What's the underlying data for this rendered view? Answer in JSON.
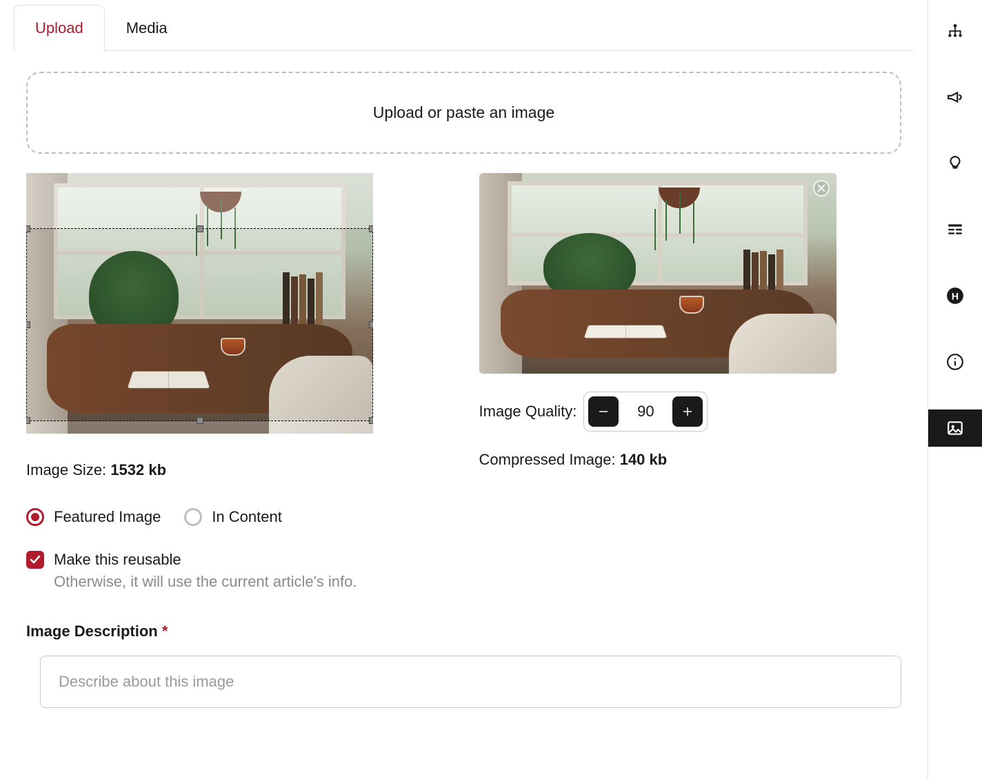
{
  "tabs": {
    "upload": "Upload",
    "media": "Media"
  },
  "dropzone": {
    "text": "Upload or paste an image"
  },
  "original": {
    "size_label": "Image Size: ",
    "size_value": "1532 kb"
  },
  "quality": {
    "label": "Image Quality:",
    "value": "90"
  },
  "compressed": {
    "label": "Compressed Image: ",
    "value": "140 kb"
  },
  "placement": {
    "featured": "Featured Image",
    "in_content": "In Content"
  },
  "reusable": {
    "label": "Make this reusable",
    "hint": "Otherwise, it will use the current article's info."
  },
  "description": {
    "label": "Image Description",
    "required_mark": "*",
    "placeholder": "Describe about this image"
  }
}
